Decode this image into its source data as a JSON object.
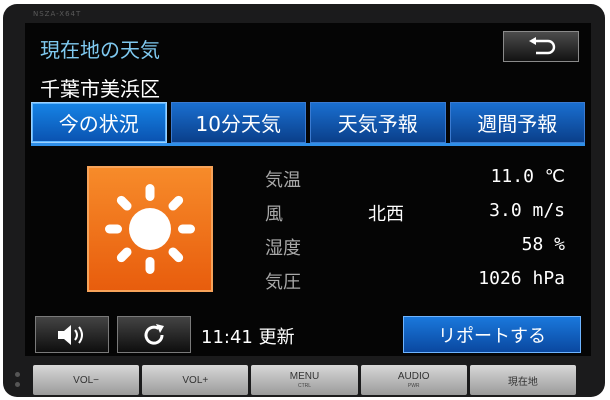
{
  "bezel": {
    "model": "NSZA-X64T"
  },
  "header": {
    "title": "現在地の天気",
    "location": "千葉市美浜区"
  },
  "tabs": [
    {
      "label": "今の状況",
      "active": true
    },
    {
      "label": "10分天気",
      "active": false
    },
    {
      "label": "天気予報",
      "active": false
    },
    {
      "label": "週間予報",
      "active": false
    }
  ],
  "weather": {
    "condition_icon": "sun-icon",
    "temperature": {
      "label": "気温",
      "value": "11.0 ℃"
    },
    "wind": {
      "label": "風",
      "direction": "北西",
      "value": "3.0 m/s"
    },
    "humidity": {
      "label": "湿度",
      "value": "58 %"
    },
    "pressure": {
      "label": "気圧",
      "value": "1026 hPa"
    }
  },
  "footer": {
    "updated": "11:41 更新",
    "report_label": "リポートする"
  },
  "hardware_buttons": [
    {
      "label": "VOL−",
      "sub": ""
    },
    {
      "label": "VOL+",
      "sub": ""
    },
    {
      "label": "MENU",
      "sub": "CTRL"
    },
    {
      "label": "AUDIO",
      "sub": "PWR"
    },
    {
      "label": "現在地",
      "sub": ""
    }
  ],
  "colors": {
    "title": "#7fc9f0",
    "tab": "#0a52b0",
    "icon_bg": "#f07a1e",
    "report": "#1a78dc"
  }
}
